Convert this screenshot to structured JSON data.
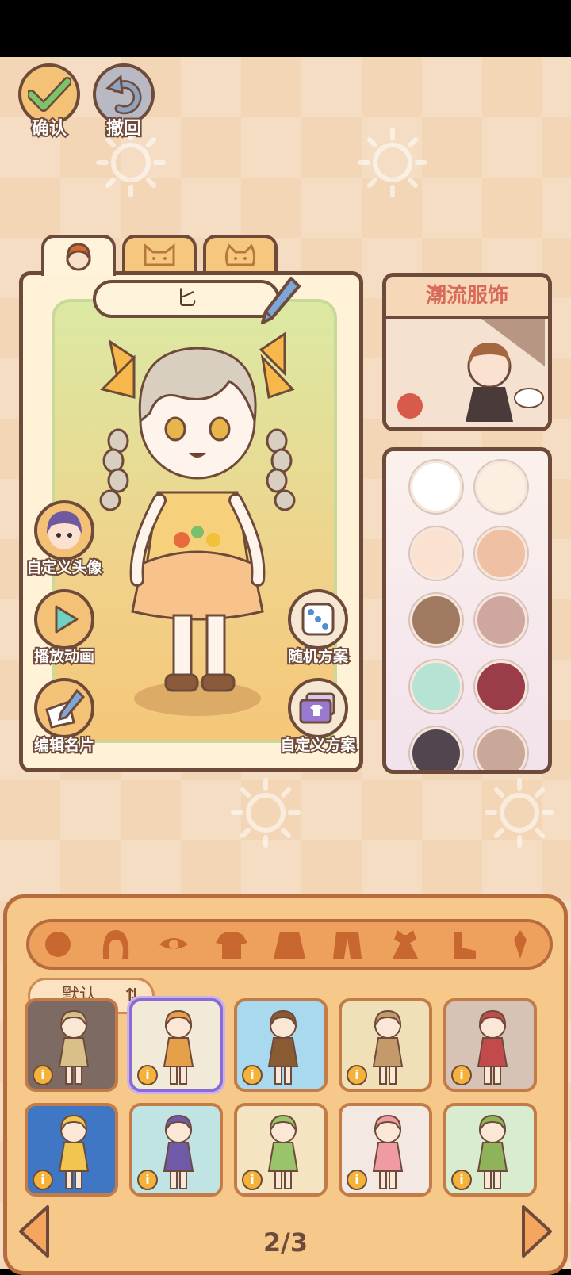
{
  "top_buttons": {
    "confirm_label": "确认",
    "undo_label": "撤回"
  },
  "tabs": [
    {
      "name": "character",
      "icon": "girl-face-icon",
      "active": true
    },
    {
      "name": "pet-cat-1",
      "icon": "cat-face-icon",
      "active": false
    },
    {
      "name": "pet-cat-2",
      "icon": "cat-face-icon",
      "active": false
    }
  ],
  "character": {
    "name": "匕"
  },
  "side_buttons": {
    "custom_avatar": "自定义头像",
    "play_animation": "播放动画",
    "edit_card": "编辑名片",
    "random_scheme": "随机方案",
    "custom_scheme": "自定义方案"
  },
  "fashion_panel": {
    "title": "潮流服饰"
  },
  "skin_colors": [
    "#ffffff",
    "#fcefe2",
    "#fbe1cf",
    "#efc0a3",
    "#a07a60",
    "#cfa6a0",
    "#b7e3d5",
    "#9b3c4a",
    "#514650",
    "#c9a89a"
  ],
  "categories": [
    "face-icon",
    "hair-icon",
    "eye-icon",
    "top-icon",
    "skirt-icon",
    "coat-icon",
    "dress-icon",
    "shoe-icon",
    "accessory-icon"
  ],
  "sort": {
    "label": "默认",
    "icon": "sort-icon"
  },
  "outfits": [
    {
      "bg": "#7d6a62",
      "accent": "#d9c08a",
      "selected": false
    },
    {
      "bg": "#f2ead9",
      "accent": "#e6a04a",
      "selected": true
    },
    {
      "bg": "#a9d9ee",
      "accent": "#8a5a33",
      "selected": false
    },
    {
      "bg": "#efe0b8",
      "accent": "#c49a6a",
      "selected": false
    },
    {
      "bg": "#d7c3b6",
      "accent": "#c24a4a",
      "selected": false
    },
    {
      "bg": "#3f77c4",
      "accent": "#f1c650",
      "selected": false
    },
    {
      "bg": "#bfe4e3",
      "accent": "#6f5aa9",
      "selected": false
    },
    {
      "bg": "#f4e4c2",
      "accent": "#9ac46a",
      "selected": false
    },
    {
      "bg": "#f4e9e2",
      "accent": "#f09aa3",
      "selected": false
    },
    {
      "bg": "#d9ecd0",
      "accent": "#8fb35a",
      "selected": false
    }
  ],
  "info_label": "i",
  "pager": {
    "text": "2/3"
  }
}
